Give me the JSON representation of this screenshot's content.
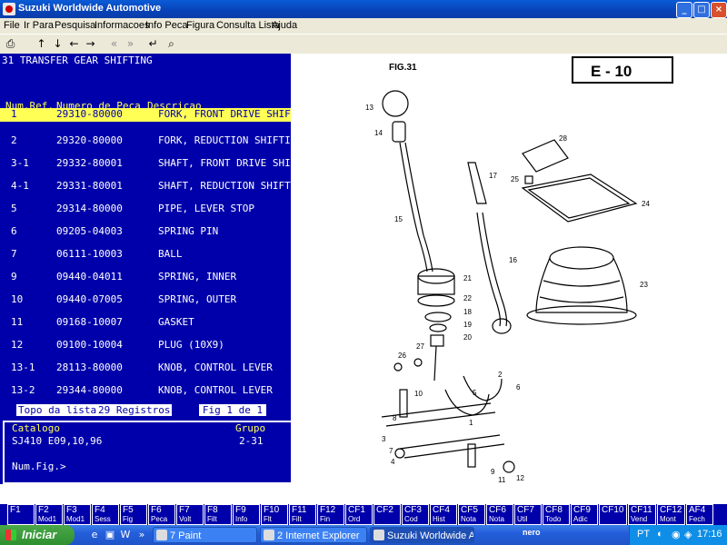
{
  "window": {
    "title": "Suzuki Worldwide Automotive"
  },
  "menu": [
    "File",
    "Ir Para",
    "Pesquisa",
    "Informacoes",
    "Info Peca",
    "Figura",
    "Consulta Lista",
    "Ajuda"
  ],
  "figure": {
    "title": "31  TRANSFER GEAR SHIFTING"
  },
  "table": {
    "headers": [
      "Num.Ref.",
      "Numero de Peca",
      "Descricao"
    ],
    "rows": [
      [
        "1",
        "29310-80000",
        "FORK, FRONT DRIVE SHIFT"
      ],
      [
        "2",
        "29320-80000",
        "FORK, REDUCTION SHIFTING"
      ],
      [
        "3-1",
        "29332-80001",
        "SHAFT, FRONT DRIVE SHIFT"
      ],
      [
        "4-1",
        "29331-80001",
        "SHAFT, REDUCTION SHIFTING"
      ],
      [
        "5",
        "29314-80000",
        "PIPE, LEVER STOP"
      ],
      [
        "6",
        "09205-04003",
        "SPRING PIN"
      ],
      [
        "7",
        "06111-10003",
        "BALL"
      ],
      [
        "9",
        "09440-04011",
        "SPRING, INNER"
      ],
      [
        "10",
        "09440-07005",
        "SPRING, OUTER"
      ],
      [
        "11",
        "09168-10007",
        "GASKET"
      ],
      [
        "12",
        "09100-10004",
        "PLUG (10X9)"
      ],
      [
        "13-1",
        "28113-80000",
        "KNOB, CONTROL LEVER"
      ],
      [
        "13-2",
        "29344-80000",
        "KNOB, CONTROL LEVER"
      ]
    ],
    "selected_index": 0
  },
  "status": {
    "top_label": "Topo da lista",
    "records": "29 Registros",
    "fig_page": "Fig 1 de 1"
  },
  "catalog": {
    "catalogo_label": "Catalogo",
    "catalogo_value": "SJ410 E09,10,96",
    "grupo_label": "Grupo",
    "grupo_value": "2-31",
    "numfig_label": "Num.Fig.>"
  },
  "drawing": {
    "fig_label": "FIG.31",
    "code": "E - 10",
    "callouts": [
      "13",
      "14",
      "15",
      "16",
      "17",
      "18",
      "19",
      "20",
      "21",
      "22",
      "23",
      "24",
      "25",
      "26",
      "27",
      "28",
      "1",
      "2",
      "5",
      "6",
      "9",
      "10",
      "11",
      "12",
      "3",
      "4",
      "7",
      "8"
    ]
  },
  "fkeys": [
    {
      "key": "F1",
      "desc": ""
    },
    {
      "key": "F2",
      "desc": "Mod1"
    },
    {
      "key": "F3",
      "desc": "Mod1"
    },
    {
      "key": "F4",
      "desc": "Sess"
    },
    {
      "key": "F5",
      "desc": "Fig"
    },
    {
      "key": "F6",
      "desc": "Peca"
    },
    {
      "key": "F7",
      "desc": "Volt"
    },
    {
      "key": "F8",
      "desc": "Filt"
    },
    {
      "key": "F9",
      "desc": "Info"
    },
    {
      "key": "F10",
      "desc": "Flt"
    },
    {
      "key": "F11",
      "desc": "Filt"
    },
    {
      "key": "F12",
      "desc": "Fin"
    },
    {
      "key": "CF1",
      "desc": "Ord"
    },
    {
      "key": "CF2",
      "desc": ""
    },
    {
      "key": "CF3",
      "desc": "Cod"
    },
    {
      "key": "CF4",
      "desc": "Hist"
    },
    {
      "key": "CF5",
      "desc": "Nota"
    },
    {
      "key": "CF6",
      "desc": "Nota"
    },
    {
      "key": "CF7",
      "desc": "Util"
    },
    {
      "key": "CF8",
      "desc": "Todo"
    },
    {
      "key": "CF9",
      "desc": "Adic"
    },
    {
      "key": "CF10",
      "desc": ""
    },
    {
      "key": "CF11",
      "desc": "Vend"
    },
    {
      "key": "CF12",
      "desc": "Mont"
    },
    {
      "key": "AF4",
      "desc": "Fech"
    }
  ],
  "taskbar": {
    "start": "Iniciar",
    "tasks": [
      {
        "label": "7 Paint",
        "active": false
      },
      {
        "label": "2 Internet Explorer",
        "active": false
      },
      {
        "label": "Suzuki Worldwide A...",
        "active": true
      }
    ],
    "language": "PT",
    "clock": "17:16",
    "nero": "nero"
  },
  "colors": {
    "panel_bg": "#0000aa",
    "highlight": "#ffff55",
    "text": "#ffffff"
  }
}
